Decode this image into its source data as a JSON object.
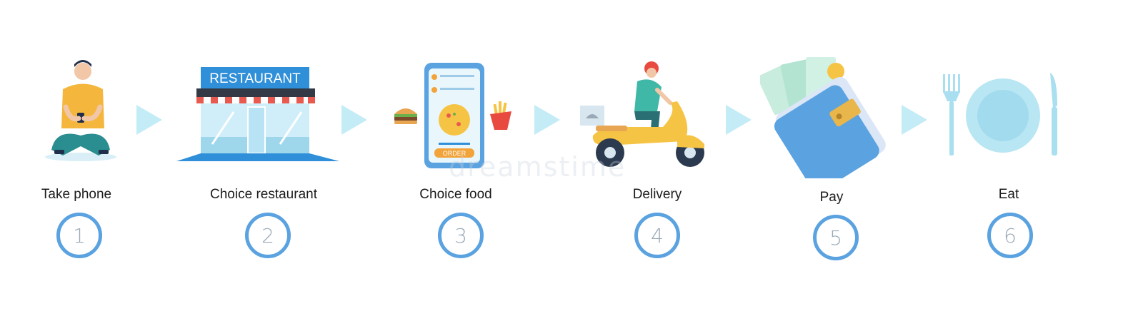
{
  "steps": [
    {
      "label": "Take phone",
      "number": "1"
    },
    {
      "label": "Choice restaurant",
      "number": "2"
    },
    {
      "label": "Choice food",
      "number": "3"
    },
    {
      "label": "Delivery",
      "number": "4"
    },
    {
      "label": "Pay",
      "number": "5"
    },
    {
      "label": "Eat",
      "number": "6"
    }
  ],
  "illustrations": {
    "restaurant_sign": "RESTAURANT",
    "order_button": "ORDER"
  },
  "watermark": "dreamstime",
  "colors": {
    "circle_border": "#5aa2e0",
    "arrow": "#c4ecf7",
    "sign_blue": "#2f8fd8",
    "scooter_yellow": "#f6c445"
  }
}
